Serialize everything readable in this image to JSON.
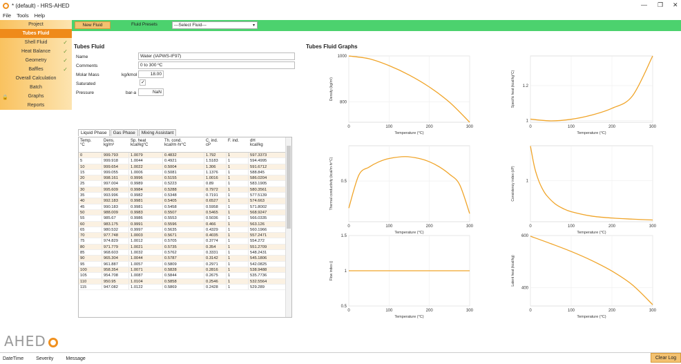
{
  "window": {
    "title": "* (default) - HRS-AHED"
  },
  "menu": [
    "File",
    "Tools",
    "Help"
  ],
  "sidebar": [
    {
      "label": "Project",
      "active": false,
      "check": false,
      "lock": false
    },
    {
      "label": "Tubes Fluid",
      "active": true,
      "check": false,
      "lock": false
    },
    {
      "label": "Shell Fluid",
      "active": false,
      "check": true,
      "lock": false
    },
    {
      "label": "Heat Balance",
      "active": false,
      "check": true,
      "lock": false
    },
    {
      "label": "Geometry",
      "active": false,
      "check": true,
      "lock": false
    },
    {
      "label": "Baffles",
      "active": false,
      "check": true,
      "lock": false
    },
    {
      "label": "Overall Calculation",
      "active": false,
      "check": false,
      "lock": false
    },
    {
      "label": "Batch",
      "active": false,
      "check": false,
      "lock": false
    },
    {
      "label": "Graphs",
      "active": false,
      "check": false,
      "lock": true
    },
    {
      "label": "Reports",
      "active": false,
      "check": false,
      "lock": false
    }
  ],
  "toolbar": {
    "new_fluid": "New Fluid",
    "presets_label": "Fluid Presets",
    "presets_value": "---Select Fluid---"
  },
  "form": {
    "title": "Tubes Fluid",
    "name_label": "Name",
    "name_value": "Water (IAPWS-IF97)",
    "comments_label": "Comments",
    "comments_value": "0 to 300 ºC",
    "molar_label": "Molar Mass",
    "molar_unit": "kg/kmol",
    "molar_value": "18.00",
    "saturated_label": "Saturated",
    "pressure_label": "Pressure",
    "pressure_unit": "bar-a",
    "pressure_value": "NaN"
  },
  "tabs": [
    "Liquid Phase",
    "Gas Phase",
    "Mixing Assistant"
  ],
  "table": {
    "headers": [
      [
        "Temp.",
        "°C"
      ],
      [
        "Dens.",
        "kg/m³"
      ],
      [
        "Sp. heat",
        "kcal/kg°C"
      ],
      [
        "Th. cond.",
        "kcal/m·hr°C"
      ],
      [
        "C. ind.",
        "cP"
      ],
      [
        "F. ind.",
        ""
      ],
      [
        "dH",
        "kcal/kg"
      ]
    ],
    "rows": [
      [
        "0",
        "999.793",
        "1.0079",
        "0.4832",
        "1.792",
        "1",
        "597.3373"
      ],
      [
        "5",
        "999.918",
        "1.0044",
        "0.4921",
        "1.5183",
        "1",
        "594.4995"
      ],
      [
        "10",
        "999.654",
        "1.0022",
        "0.5004",
        "1.306",
        "1",
        "591.6712"
      ],
      [
        "15",
        "999.055",
        "1.0006",
        "0.5081",
        "1.1376",
        "1",
        "588.845"
      ],
      [
        "20",
        "998.161",
        "0.9996",
        "0.5155",
        "1.0016",
        "1",
        "586.0204"
      ],
      [
        "25",
        "997.004",
        "0.9989",
        "0.5223",
        "0.89",
        "1",
        "583.1905"
      ],
      [
        "30",
        "995.609",
        "0.9984",
        "0.5288",
        "0.7972",
        "1",
        "580.3561"
      ],
      [
        "35",
        "993.996",
        "0.9982",
        "0.5348",
        "0.7191",
        "1",
        "577.5139"
      ],
      [
        "40",
        "992.183",
        "0.9981",
        "0.5405",
        "0.6527",
        "1",
        "574.663"
      ],
      [
        "45",
        "990.183",
        "0.9981",
        "0.5458",
        "0.5958",
        "1",
        "571.8002"
      ],
      [
        "50",
        "988.009",
        "0.9983",
        "0.5507",
        "0.5465",
        "1",
        "568.9247"
      ],
      [
        "55",
        "985.67",
        "0.9986",
        "0.5553",
        "0.5036",
        "1",
        "566.0335"
      ],
      [
        "60",
        "983.175",
        "0.9991",
        "0.5596",
        "0.466",
        "1",
        "563.126"
      ],
      [
        "65",
        "980.532",
        "0.9997",
        "0.5635",
        "0.4329",
        "1",
        "560.1966"
      ],
      [
        "70",
        "977.748",
        "1.0003",
        "0.5671",
        "0.4035",
        "1",
        "557.2471"
      ],
      [
        "75",
        "974.829",
        "1.0012",
        "0.5705",
        "0.3774",
        "1",
        "554.272"
      ],
      [
        "80",
        "971.779",
        "1.0021",
        "0.5735",
        "0.354",
        "1",
        "551.2709"
      ],
      [
        "85",
        "968.603",
        "1.0032",
        "0.5762",
        "0.3331",
        "1",
        "548.2431"
      ],
      [
        "90",
        "965.304",
        "1.0044",
        "0.5787",
        "0.3142",
        "1",
        "545.1806"
      ],
      [
        "95",
        "961.887",
        "1.0057",
        "0.5809",
        "0.2971",
        "1",
        "542.0825"
      ],
      [
        "100",
        "958.354",
        "1.0071",
        "0.5828",
        "0.2816",
        "1",
        "538.9488"
      ],
      [
        "105",
        "954.708",
        "1.0087",
        "0.5844",
        "0.2675",
        "1",
        "535.7736"
      ],
      [
        "110",
        "950.95",
        "1.0104",
        "0.5858",
        "0.2546",
        "1",
        "532.5564"
      ],
      [
        "115",
        "947.082",
        "1.0122",
        "0.5869",
        "0.2428",
        "1",
        "529.289"
      ]
    ]
  },
  "graphs_title": "Tubes Fluid Graphs",
  "chart_data": [
    {
      "type": "line",
      "ylabel": "Density (kg/m³)",
      "xlabel": "Temperature (°C)",
      "xlim": [
        0,
        300
      ],
      "ylim": [
        712,
        1000
      ],
      "xticks": [
        0,
        100,
        200,
        300
      ],
      "yticks": [
        800,
        1000
      ],
      "x": [
        0,
        50,
        100,
        150,
        200,
        250,
        300
      ],
      "y": [
        999.8,
        988,
        958,
        917,
        865,
        799,
        712
      ]
    },
    {
      "type": "line",
      "ylabel": "Specific heat (kcal/kg°C)",
      "xlabel": "Temperature (°C)",
      "xlim": [
        0,
        300
      ],
      "ylim": [
        0.99,
        1.37
      ],
      "xticks": [
        0,
        100,
        200,
        300
      ],
      "yticks": [
        1,
        1.2
      ],
      "x": [
        0,
        50,
        100,
        150,
        200,
        250,
        300
      ],
      "y": [
        1.008,
        0.998,
        1.007,
        1.031,
        1.07,
        1.14,
        1.37
      ]
    },
    {
      "type": "line",
      "ylabel": "Thermal conductivity (kcal/m·hr°C)",
      "xlabel": "Temperature (°C)",
      "xlim": [
        0,
        300
      ],
      "ylim": [
        0.35,
        0.63
      ],
      "xticks": [
        0,
        100,
        200,
        300
      ],
      "yticks": [
        0.5
      ],
      "x": [
        0,
        25,
        50,
        75,
        100,
        140,
        175,
        200,
        225,
        250,
        275,
        300
      ],
      "y": [
        0.4,
        0.522,
        0.551,
        0.571,
        0.583,
        0.59,
        0.583,
        0.571,
        0.552,
        0.525,
        0.487,
        0.38
      ]
    },
    {
      "type": "line",
      "ylabel": "Consistency index (cP)",
      "xlabel": "Temperature (°C)",
      "xlim": [
        0,
        300
      ],
      "ylim": [
        0.05,
        1.8
      ],
      "xticks": [
        0,
        100,
        200,
        300
      ],
      "yticks": [
        1
      ],
      "x": [
        0,
        10,
        20,
        30,
        40,
        60,
        80,
        100,
        150,
        200,
        250,
        300
      ],
      "y": [
        1.792,
        1.306,
        1.0016,
        0.7972,
        0.6527,
        0.466,
        0.354,
        0.2816,
        0.18,
        0.135,
        0.11,
        0.09
      ]
    },
    {
      "type": "line",
      "ylabel": "Flow index ()",
      "xlabel": "Temperature (°C)",
      "xlim": [
        0,
        300
      ],
      "ylim": [
        0.5,
        1.5
      ],
      "xticks": [
        0,
        100,
        200,
        300
      ],
      "yticks": [
        0.5,
        1,
        1.5
      ],
      "x": [
        0,
        300
      ],
      "y": [
        1,
        1
      ]
    },
    {
      "type": "line",
      "ylabel": "Latent heat (kcal/kg)",
      "xlabel": "Temperature (°C)",
      "xlim": [
        0,
        300
      ],
      "ylim": [
        330,
        600
      ],
      "xticks": [
        0,
        100,
        200,
        300
      ],
      "yticks": [
        400,
        600
      ],
      "x": [
        0,
        50,
        100,
        150,
        200,
        250,
        300
      ],
      "y": [
        597.3,
        568.9,
        538.9,
        504.5,
        463.7,
        411,
        335
      ]
    }
  ],
  "statusbar": {
    "datetime": "DateTime",
    "severity": "Severity",
    "message": "Message",
    "clear": "Clear Log"
  },
  "logo": "AHED",
  "colors": {
    "accent": "#ef8a1a",
    "toolbar": "#4cd26e",
    "curve": "#f0a428"
  }
}
